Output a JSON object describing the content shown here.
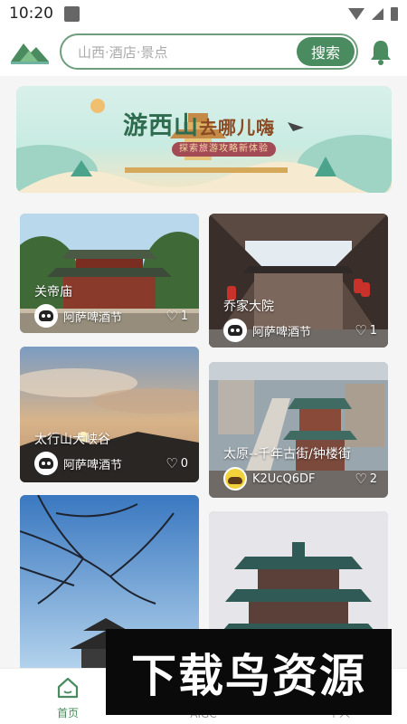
{
  "status_bar": {
    "time": "10:20"
  },
  "header": {
    "search_placeholder": "山西·酒店·景点",
    "search_button": "搜索"
  },
  "banner": {
    "title_main": "游西山",
    "title_small": "去哪儿嗨",
    "subtitle": "探索旅游攻略新体验"
  },
  "feed": {
    "cards": [
      {
        "title": "关帝庙",
        "author": "阿萨啤酒节",
        "likes": "1"
      },
      {
        "title": "乔家大院",
        "author": "阿萨啤酒节",
        "likes": "1"
      },
      {
        "title": "太行山大峡谷",
        "author": "阿萨啤酒节",
        "likes": "0"
      },
      {
        "title": "太原--千年古街/钟楼街",
        "author": "K2UcQ6DF",
        "likes": "2"
      }
    ]
  },
  "bottom_nav": {
    "items": [
      {
        "label": "首页",
        "active": true
      },
      {
        "label": "AIGC",
        "active": false
      },
      {
        "label": "个人",
        "active": false
      }
    ]
  },
  "watermark": {
    "text": "下载鸟资源"
  },
  "colors": {
    "accent": "#4a8c5f",
    "search_border": "#6e9e7c"
  }
}
